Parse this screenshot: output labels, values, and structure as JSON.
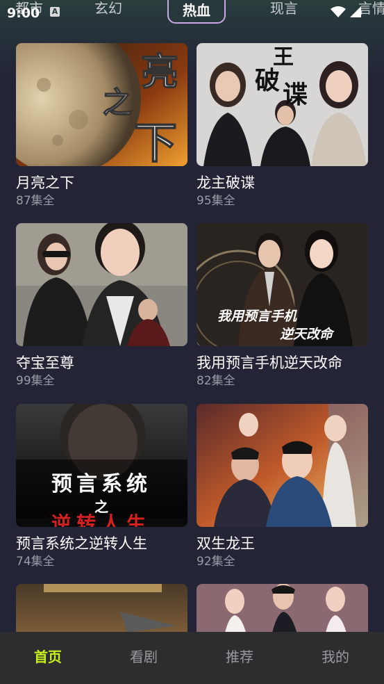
{
  "status_bar": {
    "time": "9:00",
    "notification_icon": "A"
  },
  "category_tabs": [
    {
      "label": "都市",
      "active": false
    },
    {
      "label": "玄幻",
      "active": false
    },
    {
      "label": "热血",
      "active": true
    },
    {
      "label": "现言",
      "active": false
    },
    {
      "label": "言情",
      "active": false
    }
  ],
  "dramas": [
    {
      "title": "月亮之下",
      "episodes": "87集全",
      "cover_text": "亮之下"
    },
    {
      "title": "龙主破谍",
      "episodes": "95集全",
      "cover_text": "破谍"
    },
    {
      "title": "夺宝至尊",
      "episodes": "99集全",
      "cover_text": ""
    },
    {
      "title": "我用预言手机逆天改命",
      "episodes": "82集全",
      "cover_text": "我用预言手机 逆天改命"
    },
    {
      "title": "预言系统之逆转人生",
      "episodes": "74集全",
      "cover_text": "预言系统 之 逆转人生"
    },
    {
      "title": "双生龙王",
      "episodes": "92集全",
      "cover_text": ""
    },
    {
      "title": "",
      "episodes": "",
      "cover_text": ""
    },
    {
      "title": "",
      "episodes": "",
      "cover_text": ""
    }
  ],
  "bottom_nav": [
    {
      "label": "首页",
      "active": true
    },
    {
      "label": "看剧",
      "active": false
    },
    {
      "label": "推荐",
      "active": false
    },
    {
      "label": "我的",
      "active": false
    }
  ],
  "colors": {
    "background": "#232536",
    "accent": "#c6f01e",
    "active_tab_border": "#c9a8e6",
    "nav_background": "#2d2d2f"
  }
}
